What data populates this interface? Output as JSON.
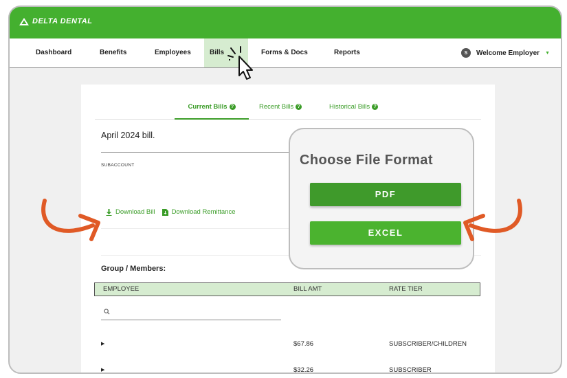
{
  "brand": {
    "name": "DELTA DENTAL",
    "green": "#44b02f",
    "active_tab_bg": "#d6ecd0",
    "arrow_color": "#e05a26"
  },
  "nav": {
    "items": [
      "Dashboard",
      "Benefits",
      "Employees",
      "Bills",
      "Forms & Docs",
      "Reports"
    ],
    "active": "Bills",
    "avatar_initial": "S",
    "welcome": "Welcome Employer"
  },
  "tabs": [
    "Current Bills",
    "Recent Bills",
    "Historical Bills"
  ],
  "bill": {
    "title": "April 2024 bill.",
    "subaccount_label": "SUBACCOUNT",
    "download_bill": "Download Bill",
    "download_remittance": "Download Remittance"
  },
  "members": {
    "label": "Group / Members:",
    "columns": [
      "EMPLOYEE",
      "BILL AMT",
      "RATE TIER"
    ],
    "rows": [
      {
        "bill_amt": "$67.86",
        "rate_tier": "SUBSCRIBER/CHILDREN"
      },
      {
        "bill_amt": "$32.26",
        "rate_tier": "SUBSCRIBER"
      }
    ]
  },
  "popup": {
    "title": "Choose File Format",
    "pdf": "PDF",
    "excel": "EXCEL",
    "pdf_color": "#3f9a2b",
    "excel_color": "#4bb32f"
  }
}
